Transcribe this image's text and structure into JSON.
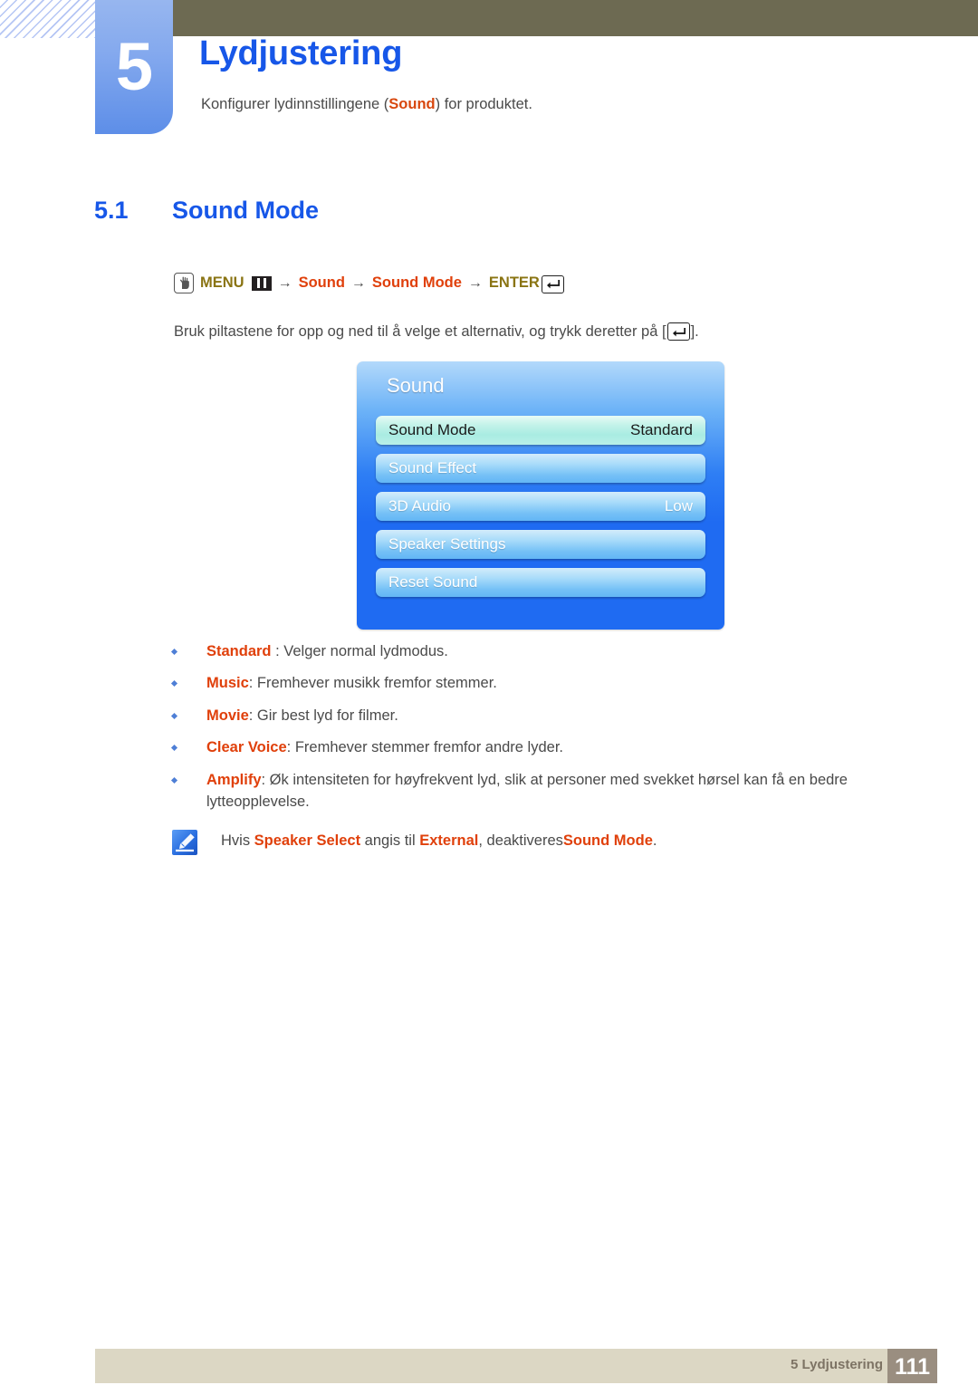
{
  "chapter": {
    "number": "5",
    "title": "Lydjustering",
    "subtitle_pre": "Konfigurer lydinnstillingene (",
    "subtitle_highlight": "Sound",
    "subtitle_post": ") for produktet."
  },
  "section": {
    "number": "5.1",
    "title": "Sound Mode"
  },
  "menu_path": {
    "hand_icon": "hand-click-icon",
    "menu_label": "MENU",
    "bars_icon": "menu-bars-icon",
    "arrow": "→",
    "step1": "Sound",
    "step2": "Sound Mode",
    "enter_label": "ENTER",
    "enter_icon": "enter-key-icon"
  },
  "instruction": {
    "before": "Bruk piltastene for opp og ned til å velge et alternativ, og trykk deretter på [",
    "after": "]."
  },
  "osd": {
    "title": "Sound",
    "rows": [
      {
        "label": "Sound Mode",
        "value": "Standard",
        "selected": true
      },
      {
        "label": "Sound Effect",
        "value": "",
        "selected": false
      },
      {
        "label": "3D Audio",
        "value": "Low",
        "selected": false
      },
      {
        "label": "Speaker Settings",
        "value": "",
        "selected": false
      },
      {
        "label": "Reset Sound",
        "value": "",
        "selected": false
      }
    ]
  },
  "bullets": [
    {
      "term": "Standard",
      "rest": " : Velger normal lydmodus."
    },
    {
      "term": "Music",
      "rest": ": Fremhever musikk fremfor stemmer."
    },
    {
      "term": "Movie",
      "rest": ": Gir best lyd for filmer."
    },
    {
      "term": "Clear Voice",
      "rest": ": Fremhever stemmer fremfor andre lyder."
    },
    {
      "term": "Amplify",
      "rest": ": Øk intensiteten for høyfrekvent lyd, slik at personer med svekket hørsel kan få en bedre lytteopplevelse."
    }
  ],
  "note": {
    "icon": "note-pen-icon",
    "p1": "Hvis ",
    "t1": "Speaker Select",
    "p2": " angis til ",
    "t2": "External",
    "p3": ", deaktiveres",
    "t3": "Sound Mode",
    "p4": "."
  },
  "footer": {
    "label": "5 Lydjustering",
    "page": "111"
  },
  "colors": {
    "heading_blue": "#1757e8",
    "term_red": "#e0400b",
    "menu_olive": "#8a7413",
    "header_khaki": "#6d6a52",
    "footer_beige": "#dcd7c4",
    "footer_page_taupe": "#9a8e80"
  }
}
